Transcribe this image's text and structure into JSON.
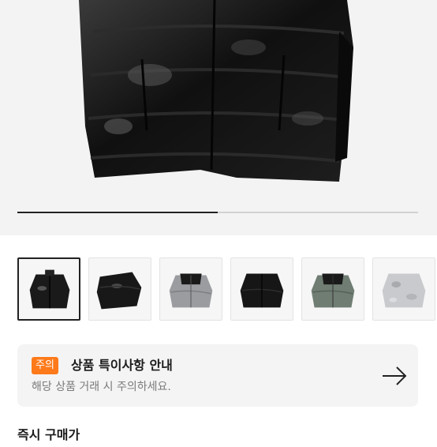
{
  "product": {
    "image": {
      "name": "black-puffer-jacket-image",
      "color": "#151515"
    },
    "carousel": {
      "progress": 0.5
    }
  },
  "thumbnails": [
    {
      "name": "black-glossy-puffer",
      "selected": true
    },
    {
      "name": "black-glossy-puffer-side",
      "selected": false
    },
    {
      "name": "silver-black-puffer",
      "selected": false
    },
    {
      "name": "black-matte-puffer",
      "selected": false
    },
    {
      "name": "green-black-puffer",
      "selected": false
    },
    {
      "name": "silver-camo-puffer",
      "selected": false
    }
  ],
  "notice": {
    "tag": "주의",
    "title": "상품 특이사항 안내",
    "description": "해당 상품 거래 시 주의하세요.",
    "tag_color": "#ff7a1a",
    "arrow_icon": "arrow-right-icon"
  },
  "next_section": {
    "title": "즉시 구매가"
  }
}
